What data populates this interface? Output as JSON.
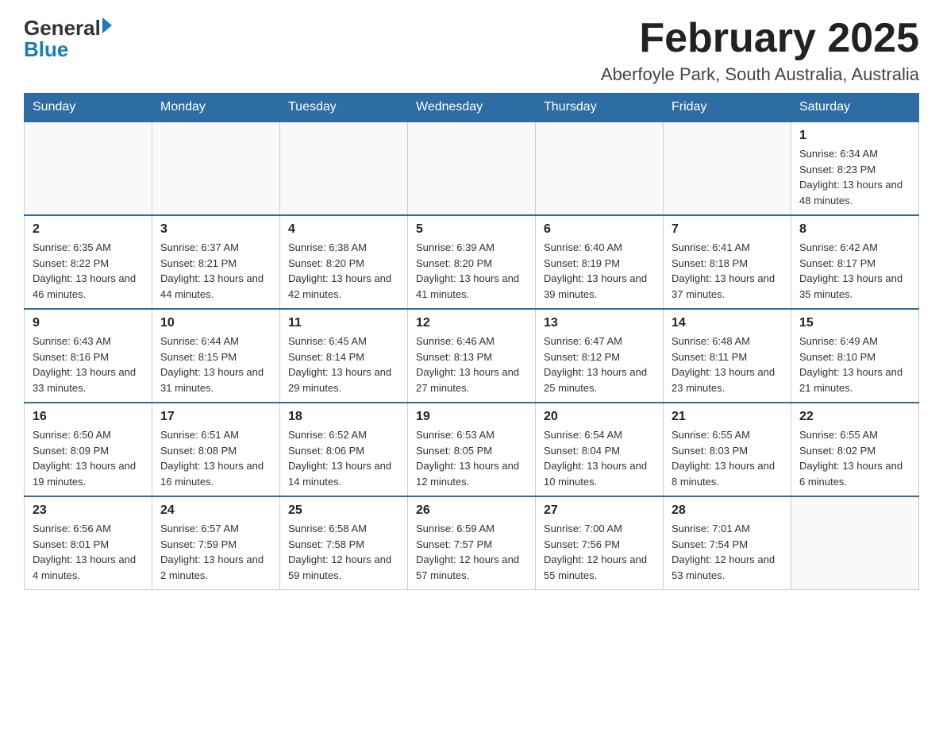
{
  "header": {
    "logo": {
      "general": "General",
      "arrow": "▶",
      "blue": "Blue"
    },
    "title": "February 2025",
    "location": "Aberfoyle Park, South Australia, Australia"
  },
  "days_of_week": [
    "Sunday",
    "Monday",
    "Tuesday",
    "Wednesday",
    "Thursday",
    "Friday",
    "Saturday"
  ],
  "weeks": [
    [
      {
        "day": "",
        "info": ""
      },
      {
        "day": "",
        "info": ""
      },
      {
        "day": "",
        "info": ""
      },
      {
        "day": "",
        "info": ""
      },
      {
        "day": "",
        "info": ""
      },
      {
        "day": "",
        "info": ""
      },
      {
        "day": "1",
        "info": "Sunrise: 6:34 AM\nSunset: 8:23 PM\nDaylight: 13 hours and 48 minutes."
      }
    ],
    [
      {
        "day": "2",
        "info": "Sunrise: 6:35 AM\nSunset: 8:22 PM\nDaylight: 13 hours and 46 minutes."
      },
      {
        "day": "3",
        "info": "Sunrise: 6:37 AM\nSunset: 8:21 PM\nDaylight: 13 hours and 44 minutes."
      },
      {
        "day": "4",
        "info": "Sunrise: 6:38 AM\nSunset: 8:20 PM\nDaylight: 13 hours and 42 minutes."
      },
      {
        "day": "5",
        "info": "Sunrise: 6:39 AM\nSunset: 8:20 PM\nDaylight: 13 hours and 41 minutes."
      },
      {
        "day": "6",
        "info": "Sunrise: 6:40 AM\nSunset: 8:19 PM\nDaylight: 13 hours and 39 minutes."
      },
      {
        "day": "7",
        "info": "Sunrise: 6:41 AM\nSunset: 8:18 PM\nDaylight: 13 hours and 37 minutes."
      },
      {
        "day": "8",
        "info": "Sunrise: 6:42 AM\nSunset: 8:17 PM\nDaylight: 13 hours and 35 minutes."
      }
    ],
    [
      {
        "day": "9",
        "info": "Sunrise: 6:43 AM\nSunset: 8:16 PM\nDaylight: 13 hours and 33 minutes."
      },
      {
        "day": "10",
        "info": "Sunrise: 6:44 AM\nSunset: 8:15 PM\nDaylight: 13 hours and 31 minutes."
      },
      {
        "day": "11",
        "info": "Sunrise: 6:45 AM\nSunset: 8:14 PM\nDaylight: 13 hours and 29 minutes."
      },
      {
        "day": "12",
        "info": "Sunrise: 6:46 AM\nSunset: 8:13 PM\nDaylight: 13 hours and 27 minutes."
      },
      {
        "day": "13",
        "info": "Sunrise: 6:47 AM\nSunset: 8:12 PM\nDaylight: 13 hours and 25 minutes."
      },
      {
        "day": "14",
        "info": "Sunrise: 6:48 AM\nSunset: 8:11 PM\nDaylight: 13 hours and 23 minutes."
      },
      {
        "day": "15",
        "info": "Sunrise: 6:49 AM\nSunset: 8:10 PM\nDaylight: 13 hours and 21 minutes."
      }
    ],
    [
      {
        "day": "16",
        "info": "Sunrise: 6:50 AM\nSunset: 8:09 PM\nDaylight: 13 hours and 19 minutes."
      },
      {
        "day": "17",
        "info": "Sunrise: 6:51 AM\nSunset: 8:08 PM\nDaylight: 13 hours and 16 minutes."
      },
      {
        "day": "18",
        "info": "Sunrise: 6:52 AM\nSunset: 8:06 PM\nDaylight: 13 hours and 14 minutes."
      },
      {
        "day": "19",
        "info": "Sunrise: 6:53 AM\nSunset: 8:05 PM\nDaylight: 13 hours and 12 minutes."
      },
      {
        "day": "20",
        "info": "Sunrise: 6:54 AM\nSunset: 8:04 PM\nDaylight: 13 hours and 10 minutes."
      },
      {
        "day": "21",
        "info": "Sunrise: 6:55 AM\nSunset: 8:03 PM\nDaylight: 13 hours and 8 minutes."
      },
      {
        "day": "22",
        "info": "Sunrise: 6:55 AM\nSunset: 8:02 PM\nDaylight: 13 hours and 6 minutes."
      }
    ],
    [
      {
        "day": "23",
        "info": "Sunrise: 6:56 AM\nSunset: 8:01 PM\nDaylight: 13 hours and 4 minutes."
      },
      {
        "day": "24",
        "info": "Sunrise: 6:57 AM\nSunset: 7:59 PM\nDaylight: 13 hours and 2 minutes."
      },
      {
        "day": "25",
        "info": "Sunrise: 6:58 AM\nSunset: 7:58 PM\nDaylight: 12 hours and 59 minutes."
      },
      {
        "day": "26",
        "info": "Sunrise: 6:59 AM\nSunset: 7:57 PM\nDaylight: 12 hours and 57 minutes."
      },
      {
        "day": "27",
        "info": "Sunrise: 7:00 AM\nSunset: 7:56 PM\nDaylight: 12 hours and 55 minutes."
      },
      {
        "day": "28",
        "info": "Sunrise: 7:01 AM\nSunset: 7:54 PM\nDaylight: 12 hours and 53 minutes."
      },
      {
        "day": "",
        "info": ""
      }
    ]
  ]
}
